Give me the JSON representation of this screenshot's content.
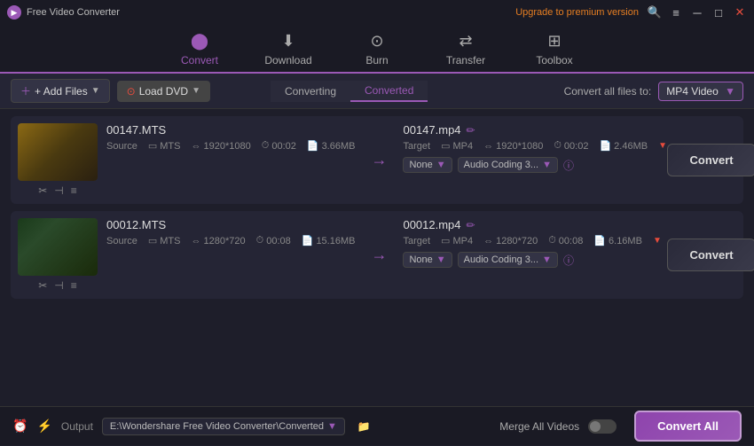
{
  "titleBar": {
    "appName": "Free Video Converter",
    "upgradeText": "Upgrade to premium version",
    "windowControls": [
      "search",
      "menu",
      "minimize",
      "maximize",
      "close"
    ]
  },
  "nav": {
    "items": [
      {
        "id": "convert",
        "label": "Convert",
        "icon": "▶",
        "active": true
      },
      {
        "id": "download",
        "label": "Download",
        "icon": "⬇"
      },
      {
        "id": "burn",
        "label": "Burn",
        "icon": "⊙"
      },
      {
        "id": "transfer",
        "label": "Transfer",
        "icon": "⇄"
      },
      {
        "id": "toolbox",
        "label": "Toolbox",
        "icon": "⊞"
      }
    ]
  },
  "toolbar": {
    "addFilesLabel": "+ Add Files",
    "loadDvdLabel": "Load DVD",
    "tabs": [
      {
        "label": "Converting",
        "active": false
      },
      {
        "label": "Converted",
        "active": true
      }
    ],
    "convertAllLabel": "Convert all files to:",
    "formatOptions": [
      "MP4 Video"
    ],
    "selectedFormat": "MP4 Video"
  },
  "files": [
    {
      "id": "file1",
      "sourceName": "00147.MTS",
      "targetName": "00147.mp4",
      "thumbnail": "1",
      "source": {
        "format": "MTS",
        "resolution": "1920*1080",
        "duration": "00:02",
        "size": "3.66MB"
      },
      "target": {
        "format": "MP4",
        "resolution": "1920*1080",
        "duration": "00:02",
        "size": "2.46MB"
      },
      "audioOption": "None",
      "audioCoding": "Audio Coding 3...",
      "convertLabel": "Convert"
    },
    {
      "id": "file2",
      "sourceName": "00012.MTS",
      "targetName": "00012.mp4",
      "thumbnail": "2",
      "source": {
        "format": "MTS",
        "resolution": "1280*720",
        "duration": "00:08",
        "size": "15.16MB"
      },
      "target": {
        "format": "MP4",
        "resolution": "1280*720",
        "duration": "00:08",
        "size": "6.16MB"
      },
      "audioOption": "None",
      "audioCoding": "Audio Coding 3...",
      "convertLabel": "Convert"
    }
  ],
  "bottomBar": {
    "outputLabel": "Output",
    "outputPath": "E:\\Wondershare Free Video Converter\\Converted",
    "mergeLabel": "Merge All Videos",
    "convertAllLabel": "Convert All"
  }
}
